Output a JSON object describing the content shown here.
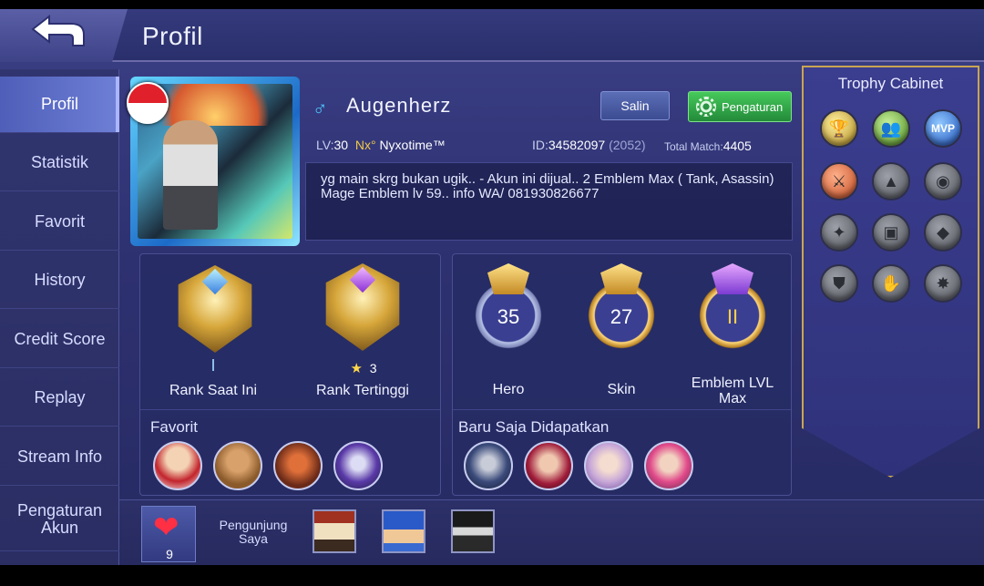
{
  "header": {
    "title": "Profil"
  },
  "sidebar": {
    "items": [
      {
        "label": "Profil",
        "active": true
      },
      {
        "label": "Statistik"
      },
      {
        "label": "Favorit"
      },
      {
        "label": "History"
      },
      {
        "label": "Credit Score"
      },
      {
        "label": "Replay"
      },
      {
        "label": "Stream Info"
      },
      {
        "label": "Pengaturan Akun"
      }
    ]
  },
  "profile": {
    "country_flag": "indonesia-flag",
    "gender_symbol": "♂",
    "name": "Augenherz",
    "copy_button": "Salin",
    "settings_button": "Pengaturan",
    "level_label": "LV:",
    "level": "30",
    "guild_tag": "Nx°",
    "squad_name": "Nyxotime™",
    "id_label": "ID:",
    "id": "34582097",
    "server": "(2052)",
    "total_match_label": "Total Match:",
    "total_match": "4405",
    "bio": "yg main skrg bukan ugik.. - Akun ini dijual.. 2 Emblem Max ( Tank, Asassin) Mage Emblem lv 59.. info WA/ 081930826677"
  },
  "rank": {
    "current_label": "Rank Saat Ini",
    "current_tier": "I",
    "highest_label": "Rank Tertinggi",
    "highest_stars": "3"
  },
  "collection": {
    "hero_label": "Hero",
    "hero_count": "35",
    "skin_label": "Skin",
    "skin_count": "27",
    "emblem_label": "Emblem LVL Max",
    "emblem_count": "II"
  },
  "favorit": {
    "title": "Favorit",
    "heroes": [
      "hero-1",
      "hero-2",
      "hero-3",
      "hero-4"
    ]
  },
  "recent": {
    "title": "Baru Saja Didapatkan",
    "heroes": [
      "hero-5",
      "hero-6",
      "hero-7",
      "hero-8"
    ]
  },
  "trophy": {
    "title": "Trophy Cabinet",
    "mvp_text": "MVP"
  },
  "bottom": {
    "like_count": "9",
    "visitors_label": "Pengunjung Saya"
  },
  "colors": {
    "accent_green": "#3cb950",
    "gold": "#d6a63a",
    "background": "#2e3170"
  }
}
